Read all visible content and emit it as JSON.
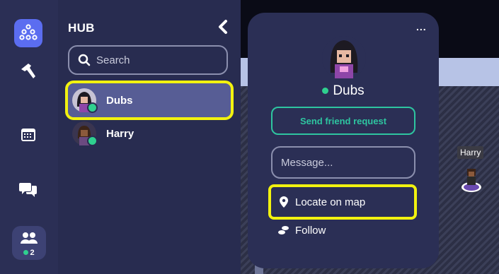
{
  "hub": {
    "title": "HUB",
    "search_placeholder": "Search",
    "users": [
      {
        "name": "Dubs",
        "selected": true,
        "status": "online"
      },
      {
        "name": "Harry",
        "selected": false,
        "status": "online"
      }
    ]
  },
  "rail": {
    "items": [
      {
        "icon": "network-icon",
        "active": true
      },
      {
        "icon": "hammer-icon"
      },
      {
        "icon": "calendar-icon"
      },
      {
        "icon": "chat-bubbles-icon"
      },
      {
        "icon": "people-icon",
        "active": true
      }
    ],
    "online_count": "2"
  },
  "map": {
    "player_label": "Harry"
  },
  "profile": {
    "more_label": "...",
    "name": "Dubs",
    "friend_button": "Send friend request",
    "message_placeholder": "Message...",
    "locate_label": "Locate on map",
    "follow_label": "Follow"
  },
  "colors": {
    "accent_green": "#2ec5a0",
    "online": "#2fd08f",
    "highlight": "#f2f20f",
    "rail_active": "#5b6df0"
  }
}
